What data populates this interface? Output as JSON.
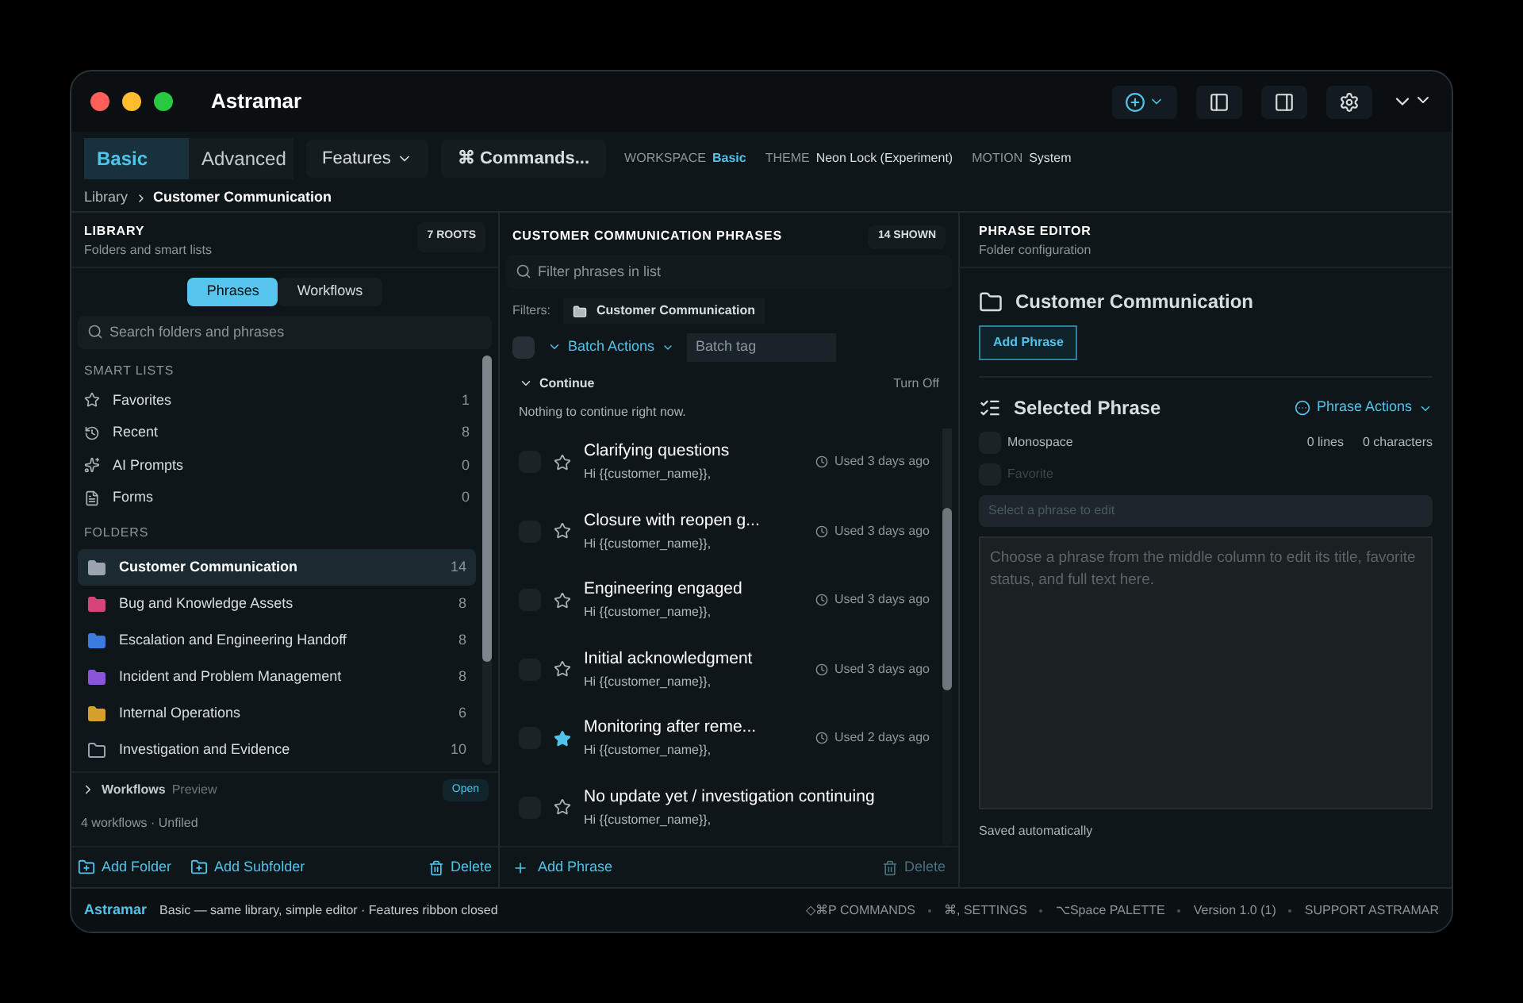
{
  "window": {
    "title": "Astramar"
  },
  "toolbar": {
    "modes": [
      {
        "label": "Basic",
        "selected": true
      },
      {
        "label": "Advanced",
        "selected": false
      }
    ],
    "features": "Features",
    "commands": "⌘ Commands...",
    "meta": [
      {
        "label": "WORKSPACE",
        "value": "Basic",
        "accent": true
      },
      {
        "label": "THEME",
        "value": "Neon Lock (Experiment)",
        "accent": false
      },
      {
        "label": "MOTION",
        "value": "System",
        "accent": false
      }
    ]
  },
  "breadcrumb": [
    "Library",
    "Customer Communication"
  ],
  "library": {
    "title": "LIBRARY",
    "subtitle": "Folders and smart lists",
    "badge": "7 ROOTS",
    "tabs": [
      {
        "label": "Phrases",
        "selected": true
      },
      {
        "label": "Workflows",
        "selected": false
      }
    ],
    "search": {
      "placeholder": "Search folders and phrases"
    },
    "smart_lists_heading": "SMART LISTS",
    "smart_lists": [
      {
        "label": "Favorites",
        "count": "1"
      },
      {
        "label": "Recent",
        "count": "8"
      },
      {
        "label": "AI Prompts",
        "count": "0"
      },
      {
        "label": "Forms",
        "count": "0"
      }
    ],
    "folders_heading": "FOLDERS",
    "folders": [
      {
        "label": "Customer Communication",
        "count": "14",
        "selected": true,
        "color": "#9ca3af",
        "kind": "filled"
      },
      {
        "label": "Bug and Knowledge Assets",
        "count": "8",
        "selected": false,
        "color": "#d6457a",
        "kind": "filled"
      },
      {
        "label": "Escalation and Engineering Handoff",
        "count": "8",
        "selected": false,
        "color": "#3b7be0",
        "kind": "filled"
      },
      {
        "label": "Incident and Problem Management",
        "count": "8",
        "selected": false,
        "color": "#8a55d8",
        "kind": "filled"
      },
      {
        "label": "Internal Operations",
        "count": "6",
        "selected": false,
        "color": "#d4a12a",
        "kind": "filled"
      },
      {
        "label": "Investigation and Evidence",
        "count": "10",
        "selected": false,
        "color": "#9ca3af",
        "kind": "outline"
      }
    ],
    "workflows": {
      "label": "Workflows",
      "tag": "Preview",
      "action": "Open",
      "summary": "4 workflows · Unfiled",
      "expanded": false
    },
    "actions": [
      "Add Folder",
      "Add Subfolder"
    ],
    "delete": "Delete"
  },
  "phrases": {
    "title": "CUSTOMER COMMUNICATION PHRASES",
    "badge": "14 SHOWN",
    "search": {
      "placeholder": "Filter phrases in list"
    },
    "select_all_checked": false,
    "filters_label": "Filters:",
    "filter": "Customer Communication",
    "batch_actions": "Batch Actions",
    "batch_tag": {
      "placeholder": "Batch tag"
    },
    "continue": {
      "label": "Continue",
      "action": "Turn Off",
      "empty": "Nothing to continue right now.",
      "expanded": true
    },
    "items": [
      {
        "title": "Clarifying questions",
        "preview": "Hi {{customer_name}},",
        "used": "Used 3 days ago",
        "favorite": false,
        "checked": false
      },
      {
        "title": "Closure with reopen g...",
        "preview": "Hi {{customer_name}},",
        "used": "Used 3 days ago",
        "favorite": false,
        "checked": false
      },
      {
        "title": "Engineering engaged",
        "preview": "Hi {{customer_name}},",
        "used": "Used 3 days ago",
        "favorite": false,
        "checked": false
      },
      {
        "title": "Initial acknowledgment",
        "preview": "Hi {{customer_name}},",
        "used": "Used 3 days ago",
        "favorite": false,
        "checked": false
      },
      {
        "title": "Monitoring after reme...",
        "preview": "Hi {{customer_name}},",
        "used": "Used 2 days ago",
        "favorite": true,
        "checked": false
      },
      {
        "title": "No update yet / investigation continuing",
        "preview": "Hi {{customer_name}},",
        "favorite": false,
        "checked": false
      }
    ],
    "add": "Add Phrase",
    "delete": "Delete"
  },
  "editor": {
    "title": "PHRASE EDITOR",
    "subtitle": "Folder configuration",
    "folder": "Customer Communication",
    "add": "Add Phrase",
    "selected_title": "Selected Phrase",
    "actions": "Phrase Actions",
    "monospace": {
      "label": "Monospace",
      "checked": false
    },
    "favorite": {
      "label": "Favorite",
      "checked": false,
      "disabled": true
    },
    "lines": "0 lines",
    "characters": "0 characters",
    "title_field": {
      "placeholder": "Select a phrase to edit"
    },
    "body": {
      "placeholder": "Choose a phrase from the middle column to edit its title, favorite status, and full text here."
    },
    "saved": "Saved automatically"
  },
  "status_bar": {
    "app": "Astramar",
    "message": "Basic — same library, simple editor · Features ribbon closed",
    "items": [
      "◇⌘P COMMANDS",
      "⌘, SETTINGS",
      "⌥Space PALETTE",
      "Version 1.0 (1)",
      "SUPPORT ASTRAMAR"
    ]
  }
}
